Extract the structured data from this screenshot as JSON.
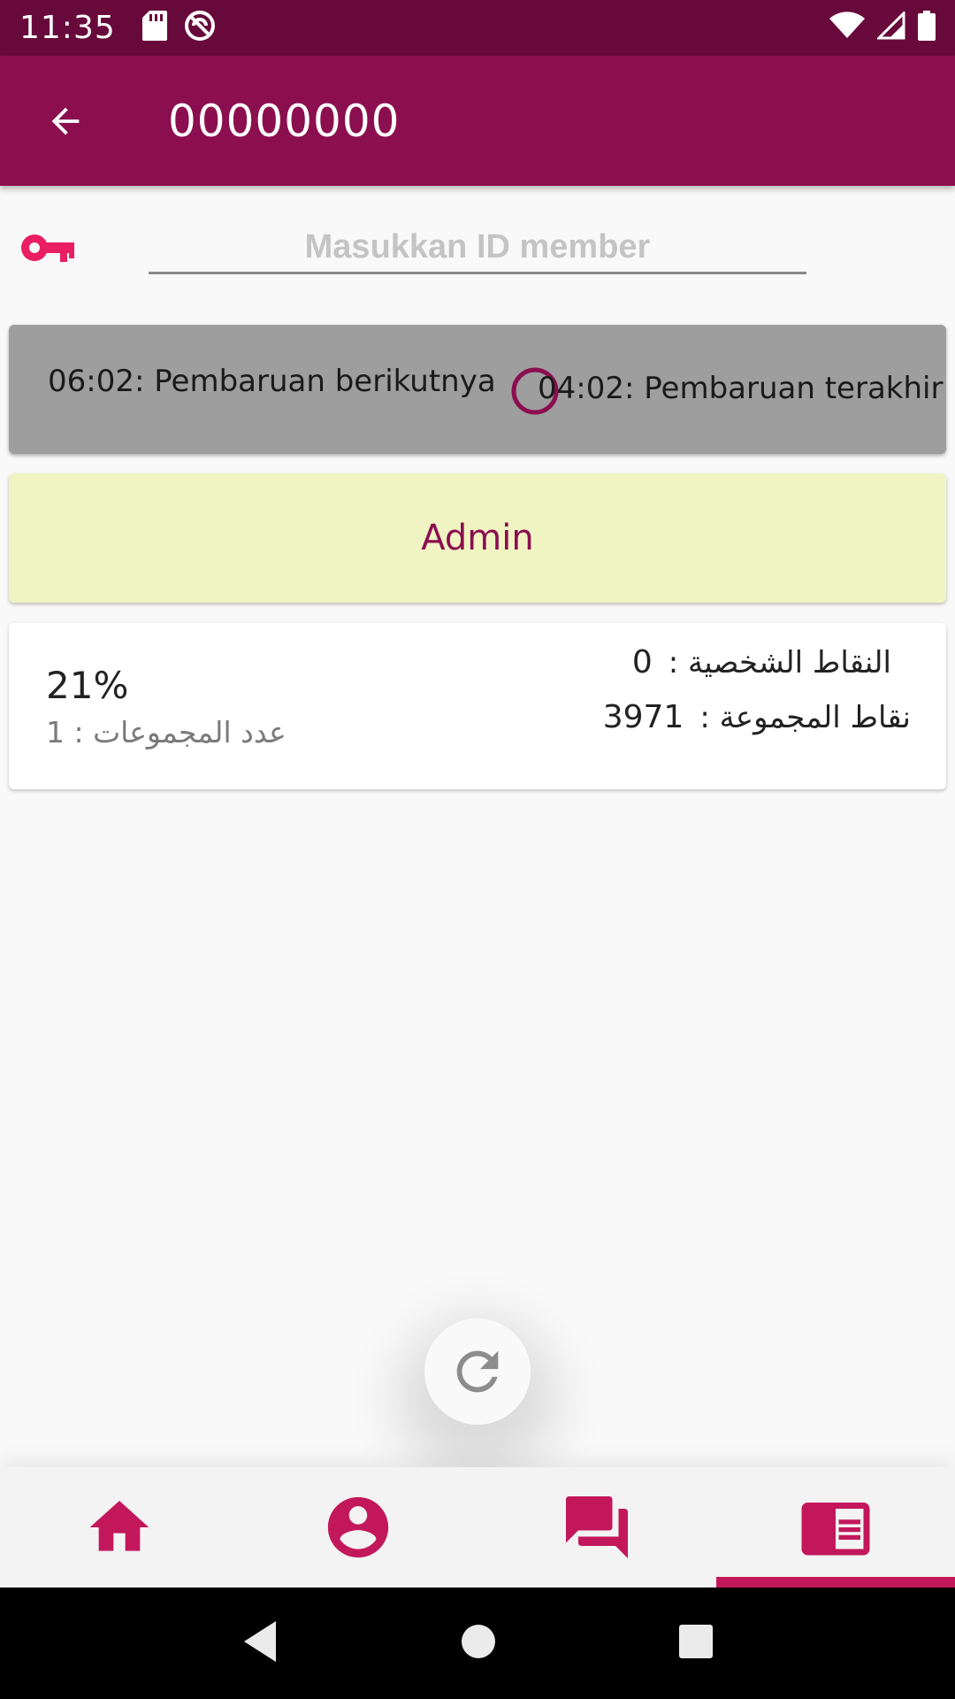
{
  "status_bar": {
    "time": "11:35",
    "left_icons": [
      "sd-card-icon",
      "no-sync-icon"
    ],
    "right_icons": [
      "wifi-icon",
      "signal-icon",
      "battery-icon"
    ]
  },
  "app_bar": {
    "title": "00000000",
    "back_icon": "arrow-back-icon",
    "color": "#8b0e4f"
  },
  "member_input": {
    "placeholder": "Masukkan ID member",
    "value": "",
    "icon": "key-icon"
  },
  "update_card": {
    "next_update": "06:02: Pembaruan berikutnya",
    "last_update": "04:02: Pembaruan terakhir",
    "icon": "clock-icon",
    "background": "#9e9e9e"
  },
  "role_card": {
    "label": "Admin",
    "background": "#f0f4c3",
    "text_color": "#8b0e4f"
  },
  "stats_card": {
    "percent": "21%",
    "groups_label": "عدد المجموعات : 1",
    "personal_points_label": "النقاط الشخصية :",
    "personal_points_value": "0",
    "group_points_label": "نقاط المجموعة :",
    "group_points_value": "3971"
  },
  "refresh_button": {
    "icon": "refresh-icon"
  },
  "bottom_nav": {
    "accent": "#c2185b",
    "items": [
      {
        "icon": "home-icon",
        "active": false
      },
      {
        "icon": "account-circle-icon",
        "active": false
      },
      {
        "icon": "forum-icon",
        "active": false
      },
      {
        "icon": "chrome-reader-icon",
        "active": true
      }
    ]
  },
  "system_nav": {
    "icons": [
      "back-triangle-icon",
      "home-circle-icon",
      "recents-square-icon"
    ]
  }
}
